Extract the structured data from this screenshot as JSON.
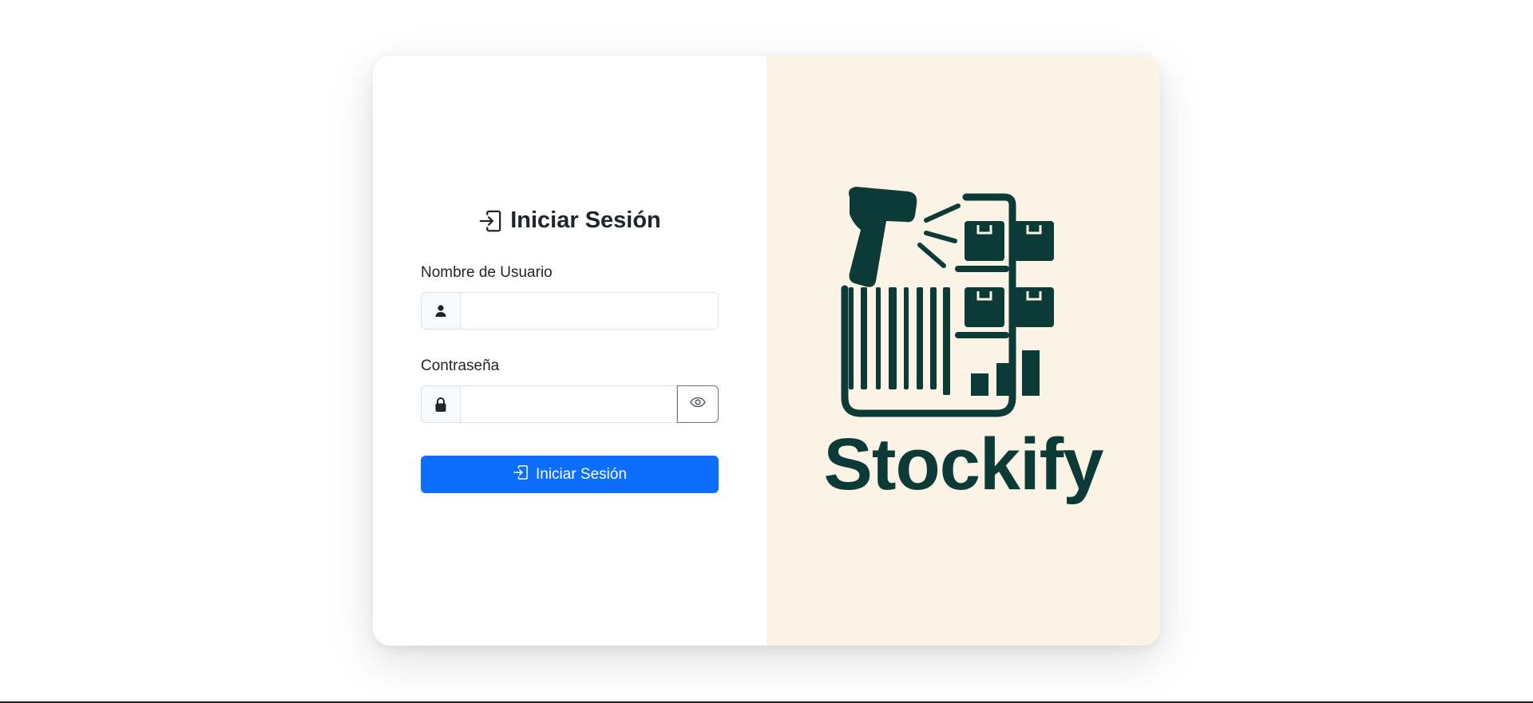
{
  "login": {
    "title": "Iniciar Sesión",
    "username_label": "Nombre de Usuario",
    "username_value": "",
    "password_label": "Contraseña",
    "password_value": "",
    "submit_label": "Iniciar Sesión"
  },
  "brand": {
    "name": "Stockify"
  },
  "icons": {
    "title": "login-icon",
    "username": "user-icon",
    "password": "lock-icon",
    "toggle": "eye-icon",
    "submit": "login-icon",
    "logo": "barcode-scanner-shelves-icon"
  },
  "colors": {
    "primary": "#0d6efd",
    "brand": "#0c3b37",
    "brand_panel_bg": "#fbf3e6",
    "text": "#212529"
  }
}
